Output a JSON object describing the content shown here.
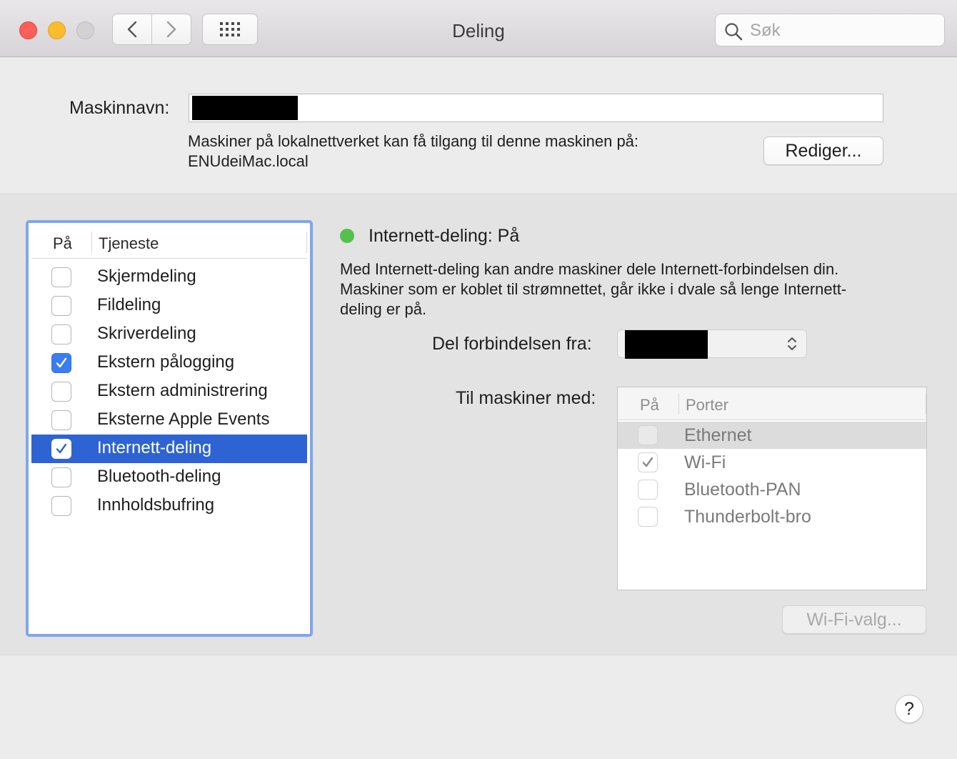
{
  "window": {
    "title": "Deling"
  },
  "toolbar": {
    "back_label": "‹",
    "forward_label": "›"
  },
  "search": {
    "placeholder": "Søk"
  },
  "computer_name": {
    "label": "Maskinnavn:",
    "description_line1": "Maskiner på lokalnettverket kan få tilgang til denne maskinen på:",
    "description_line2": "ENUdeiMac.local",
    "edit_button": "Rediger..."
  },
  "services": {
    "header_on": "På",
    "header_service": "Tjeneste",
    "items": [
      {
        "label": "Skjermdeling",
        "checked": false,
        "selected": false
      },
      {
        "label": "Fildeling",
        "checked": false,
        "selected": false
      },
      {
        "label": "Skriverdeling",
        "checked": false,
        "selected": false
      },
      {
        "label": "Ekstern pålogging",
        "checked": true,
        "selected": false
      },
      {
        "label": "Ekstern administrering",
        "checked": false,
        "selected": false
      },
      {
        "label": "Eksterne Apple Events",
        "checked": false,
        "selected": false
      },
      {
        "label": "Internett-deling",
        "checked": true,
        "selected": true
      },
      {
        "label": "Bluetooth-deling",
        "checked": false,
        "selected": false
      },
      {
        "label": "Innholdsbufring",
        "checked": false,
        "selected": false
      }
    ]
  },
  "detail": {
    "status_title": "Internett-deling: På",
    "description_line1": "Med Internett-deling kan andre maskiner dele Internett-forbindelsen din.",
    "description_line2": "Maskiner som er koblet til strømnettet, går ikke i dvale så lenge Internett-",
    "description_line3": "deling er på.",
    "share_from_label": "Del forbindelsen fra:",
    "to_computers_label": "Til maskiner med:",
    "ports": {
      "header_on": "På",
      "header_ports": "Porter",
      "items": [
        {
          "label": "Ethernet",
          "checked": false,
          "selected": true
        },
        {
          "label": "Wi-Fi",
          "checked": true,
          "selected": false
        },
        {
          "label": "Bluetooth-PAN",
          "checked": false,
          "selected": false
        },
        {
          "label": "Thunderbolt-bro",
          "checked": false,
          "selected": false
        }
      ]
    },
    "wifi_button": "Wi-Fi-valg..."
  },
  "help": {
    "label": "?"
  },
  "colors": {
    "selection": "#2e63d3",
    "focus_ring": "#80a6ee",
    "checkbox_on": "#3b7cf2",
    "status_on": "#55c14d"
  }
}
